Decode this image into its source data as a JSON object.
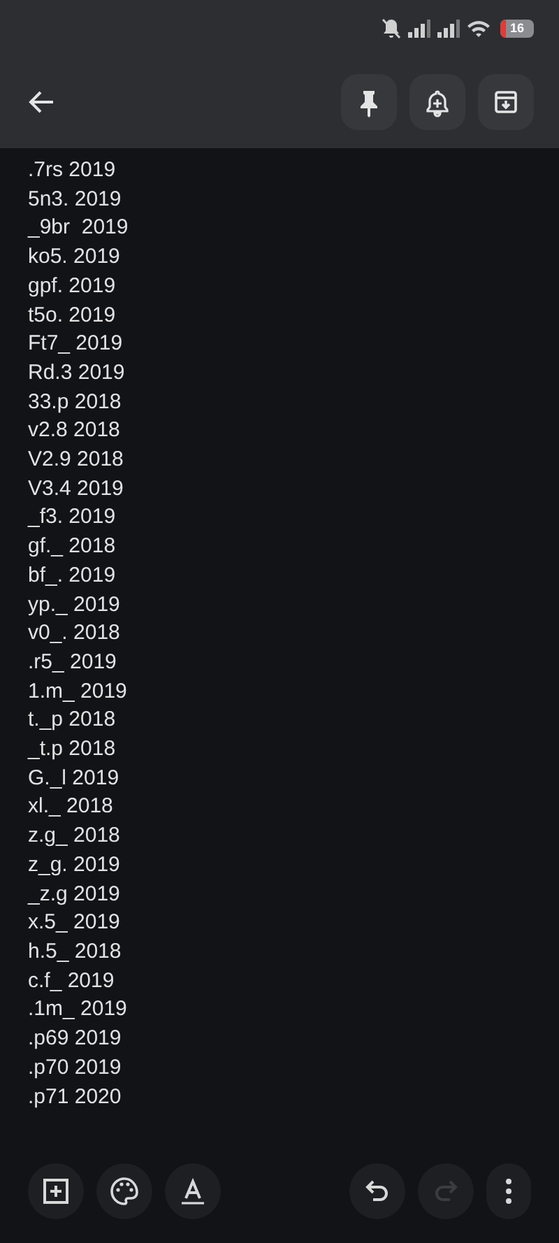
{
  "status_bar": {
    "battery": "16"
  },
  "toolbar": {
    "actions": [
      {
        "kind": "pin"
      },
      {
        "kind": "reminder"
      },
      {
        "kind": "archive"
      }
    ]
  },
  "note": {
    "lines": [
      ".7rs 2019",
      "5n3. 2019",
      "_9br  2019",
      "ko5. 2019",
      "gpf. 2019",
      "t5o. 2019",
      "Ft7_ 2019",
      "Rd.3 2019",
      "33.p 2018",
      "v2.8 2018",
      "V2.9 2018",
      "V3.4 2019",
      "_f3. 2019",
      "gf._ 2018",
      "bf_. 2019",
      "yp._ 2019",
      "v0_. 2018",
      ".r5_ 2019",
      "1.m_ 2019",
      "t._p 2018",
      "_t.p 2018",
      "G._l 2019",
      "xl._ 2018",
      "z.g_ 2018",
      "z_g. 2019",
      "_z.g 2019",
      "x.5_ 2019",
      "h.5_ 2018",
      "c.f_ 2019",
      ".1m_ 2019",
      ".p69 2019",
      ".p70 2019",
      ".p71 2020"
    ]
  },
  "bottom_bar": {
    "left": [
      {
        "kind": "add"
      },
      {
        "kind": "palette"
      },
      {
        "kind": "text"
      }
    ],
    "right": [
      {
        "kind": "undo",
        "disabled": false
      },
      {
        "kind": "redo",
        "disabled": true
      },
      {
        "kind": "more",
        "disabled": false
      }
    ]
  }
}
